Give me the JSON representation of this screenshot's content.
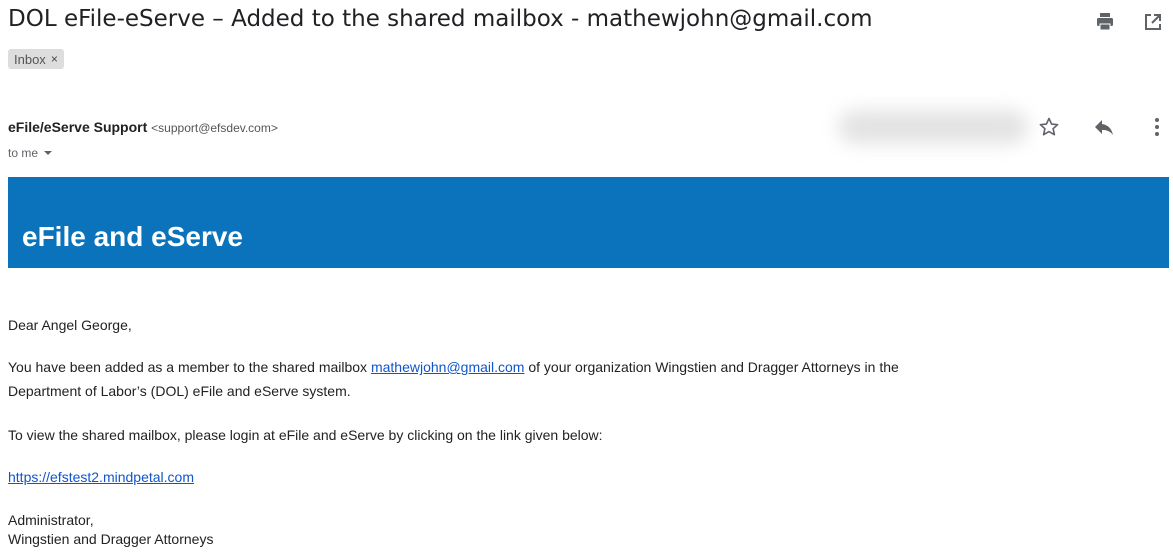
{
  "header": {
    "subject": "DOL eFile-eServe – Added to the shared mailbox - mathewjohn@gmail.com",
    "label": "Inbox",
    "label_close": "×",
    "icons": [
      "print-icon",
      "open-in-new-window-icon"
    ]
  },
  "message": {
    "sender_name": "eFile/eServe Support",
    "sender_email": "<support@efsdev.com>",
    "recipient": "to me",
    "actions": [
      "star-icon",
      "reply-icon",
      "more-options-icon"
    ]
  },
  "email_body": {
    "banner_title": "eFile and eServe",
    "greeting": "Dear Angel George,",
    "para1_before_link": "You have been added as a member to the shared mailbox ",
    "para1_link": "mathewjohn@gmail.com",
    "para1_after_link": " of your organization Wingstien and Dragger Attorneys in the",
    "para1_line2": "Department of Labor’s (DOL) eFile and eServe system.",
    "para2": "To view the shared mailbox, please login at eFile and eServe by clicking on the link given below:",
    "login_link": "https://efstest2.mindpetal.com",
    "signature_line1": "Administrator,",
    "signature_line2": "Wingstien and Dragger Attorneys"
  },
  "colors": {
    "banner": "#0b73bb",
    "link": "#1155cc",
    "label_chip": "#dddddd"
  }
}
